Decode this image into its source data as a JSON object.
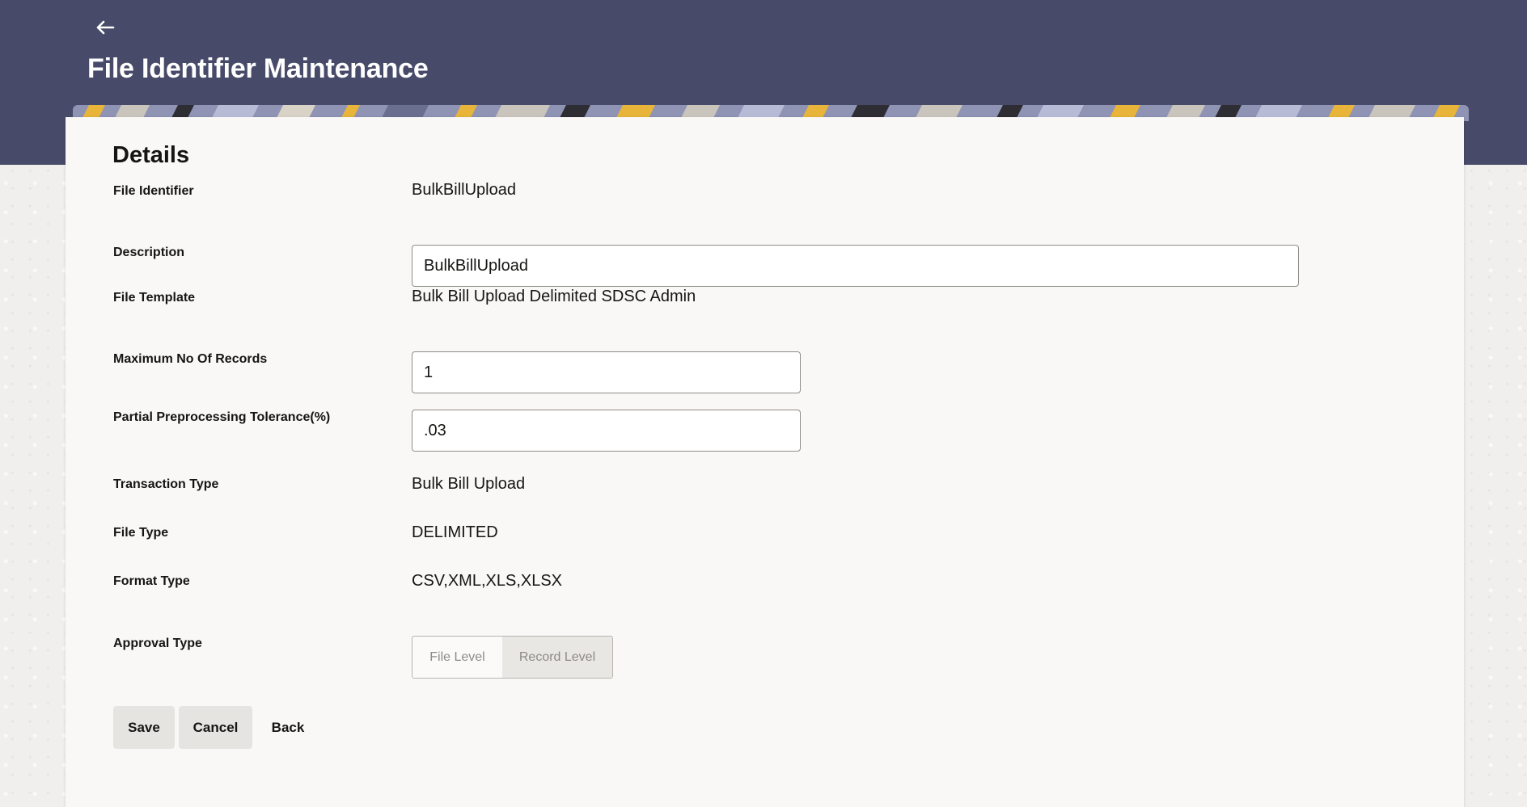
{
  "page": {
    "title": "File Identifier Maintenance",
    "back_icon": "arrow-left-icon"
  },
  "details": {
    "section_title": "Details",
    "fields": {
      "file_identifier": {
        "label": "File Identifier",
        "value": "BulkBillUpload"
      },
      "description": {
        "label": "Description",
        "value": "BulkBillUpload"
      },
      "file_template": {
        "label": "File Template",
        "value": "Bulk Bill Upload Delimited SDSC Admin"
      },
      "max_records": {
        "label": "Maximum No Of Records",
        "value": "1"
      },
      "tolerance": {
        "label": "Partial Preprocessing Tolerance(%)",
        "value": ".03"
      },
      "transaction_type": {
        "label": "Transaction Type",
        "value": "Bulk Bill Upload"
      },
      "file_type": {
        "label": "File Type",
        "value": "DELIMITED"
      },
      "format_type": {
        "label": "Format Type",
        "value": "CSV,XML,XLS,XLSX"
      },
      "approval_type": {
        "label": "Approval Type",
        "options": [
          "File Level",
          "Record Level"
        ],
        "selected": "Record Level"
      }
    }
  },
  "actions": {
    "save": "Save",
    "cancel": "Cancel",
    "back": "Back"
  },
  "colors": {
    "header_bg": "#474b69",
    "card_bg": "#f9f8f7",
    "page_bg": "#f1efed"
  }
}
